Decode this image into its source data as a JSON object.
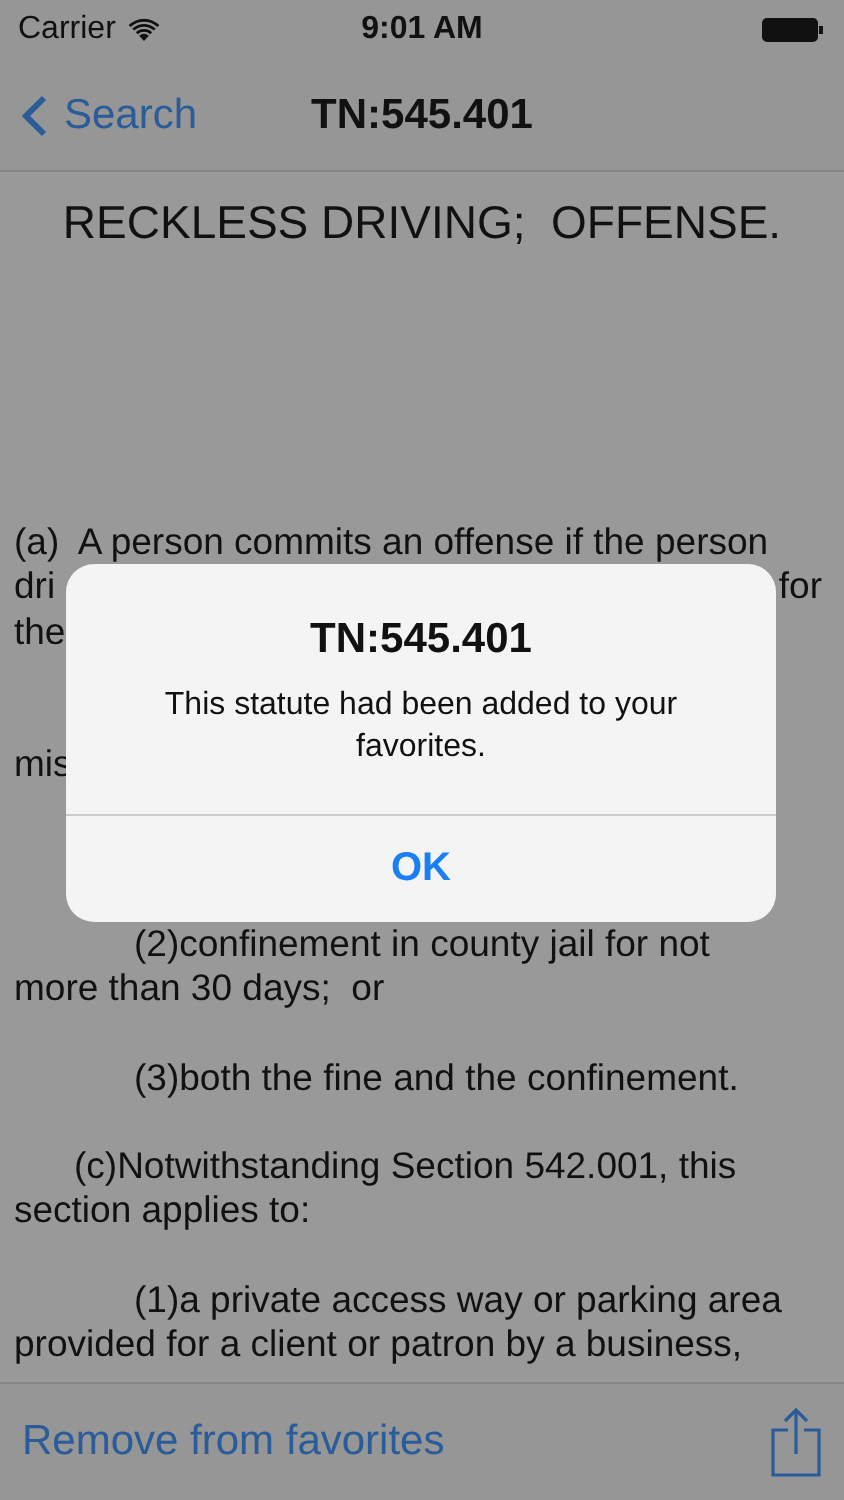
{
  "status_bar": {
    "carrier": "Carrier",
    "time": "9:01 AM"
  },
  "nav_bar": {
    "back": "Search",
    "title": "TN:545.401"
  },
  "document": {
    "heading": "RECKLESS DRIVING;  OFFENSE.",
    "lines": [
      {
        "kind": "line",
        "text": "(a)  A person commits an offense if the person"
      },
      {
        "kind": "split",
        "left": "dri",
        "right": "for"
      },
      {
        "kind": "split",
        "left": "the"
      },
      {
        "kind": "blank"
      },
      {
        "kind": "blank"
      },
      {
        "kind": "split",
        "left": "mis"
      },
      {
        "kind": "blank"
      },
      {
        "kind": "blank"
      },
      {
        "kind": "blank"
      },
      {
        "kind": "deep_line",
        "text": "(2)confinement in county jail for not"
      },
      {
        "kind": "line",
        "text": "more than 30 days;  or"
      },
      {
        "kind": "blank"
      },
      {
        "kind": "deep_line",
        "text": "(3)both the fine and the confinement."
      },
      {
        "kind": "blank"
      },
      {
        "kind": "indented_line",
        "text": "(c)Notwithstanding Section 542.001, this"
      },
      {
        "kind": "line",
        "text": "section applies to:"
      },
      {
        "kind": "blank"
      },
      {
        "kind": "deep_line",
        "text": "(1)a private access way or parking area"
      },
      {
        "kind": "line",
        "text": "provided for a client or patron by a business,"
      }
    ]
  },
  "alert": {
    "title": "TN:545.401",
    "message": "This statute had been added to your favorites.",
    "buttons": [
      "OK"
    ]
  },
  "toolbar": {
    "action": "Remove from favorites"
  }
}
